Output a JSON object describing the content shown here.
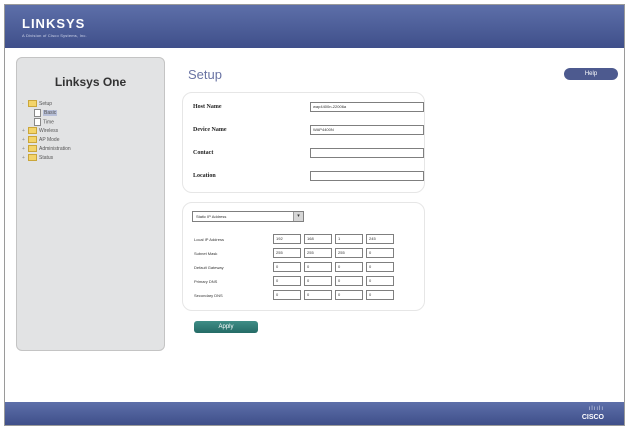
{
  "header": {
    "logo": "LINKSYS",
    "tagline": "A Division of Cisco Systems, Inc."
  },
  "sidebar": {
    "title": "Linksys One",
    "tree": [
      {
        "label": "Setup",
        "expander": "-",
        "type": "folder"
      },
      {
        "label": "Basic",
        "type": "doc",
        "selected": true
      },
      {
        "label": "Time",
        "type": "doc"
      },
      {
        "label": "Wireless",
        "expander": "+",
        "type": "folder"
      },
      {
        "label": "AP Mode",
        "expander": "+",
        "type": "folder"
      },
      {
        "label": "Administration",
        "expander": "+",
        "type": "folder"
      },
      {
        "label": "Status",
        "expander": "+",
        "type": "folder"
      }
    ]
  },
  "main": {
    "title": "Setup",
    "help_label": "Help",
    "host_name": {
      "label": "Host Name",
      "value": "wap4400n-22006a"
    },
    "device_name": {
      "label": "Device Name",
      "value": "WAP4400N"
    },
    "contact": {
      "label": "Contact",
      "value": ""
    },
    "location": {
      "label": "Location",
      "value": ""
    },
    "ip_mode": "Static IP Address",
    "network_fields": [
      {
        "label": "Local IP Address",
        "octets": [
          "192",
          "168",
          "1",
          "245"
        ]
      },
      {
        "label": "Subnet Mask",
        "octets": [
          "255",
          "255",
          "255",
          "0"
        ]
      },
      {
        "label": "Default Gateway",
        "octets": [
          "0",
          "0",
          "0",
          "0"
        ]
      },
      {
        "label": "Primary DNS",
        "octets": [
          "0",
          "0",
          "0",
          "0"
        ]
      },
      {
        "label": "Secondary DNS",
        "octets": [
          "0",
          "0",
          "0",
          "0"
        ]
      }
    ],
    "apply_label": "Apply"
  },
  "footer": {
    "bars": "ılıılı",
    "brand": "CISCO"
  }
}
